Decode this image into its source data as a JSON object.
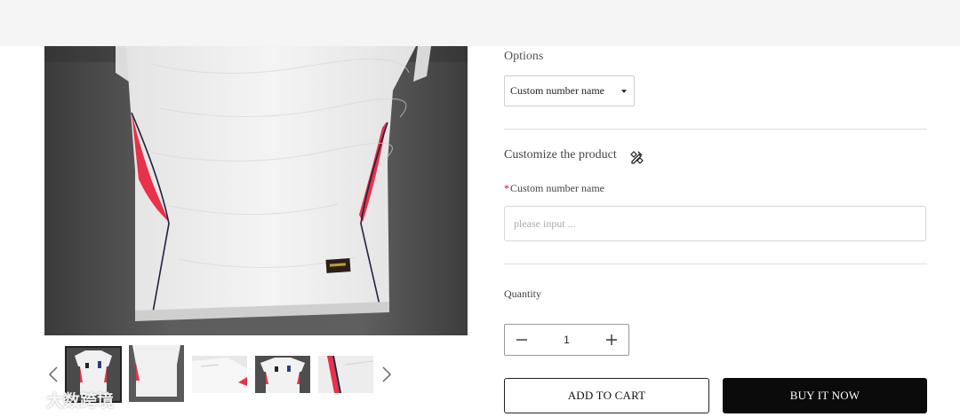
{
  "options": {
    "label": "Options",
    "selected": "Custom number name"
  },
  "customize": {
    "title": "Customize the product",
    "field_label": "Custom number name",
    "field_required_mark": "*",
    "field_placeholder": "please input ...",
    "field_value": ""
  },
  "quantity": {
    "label": "Quantity",
    "value": "1"
  },
  "buttons": {
    "add_to_cart": "ADD TO CART",
    "buy_now": "BUY IT NOW"
  },
  "gallery": {
    "thumbnail_count": 5,
    "active_thumbnail": 1
  },
  "watermark": {
    "text": "大数跨境"
  },
  "colors": {
    "accent_red": "#e8324a",
    "buy_button": "#0b0b0b",
    "required_mark": "#d0021b"
  },
  "icons": {
    "select_caret": "caret-down-icon",
    "customize": "pen-ruler-icon",
    "prev": "chevron-left-icon",
    "next": "chevron-right-icon",
    "minus": "minus-icon",
    "plus": "plus-icon"
  }
}
